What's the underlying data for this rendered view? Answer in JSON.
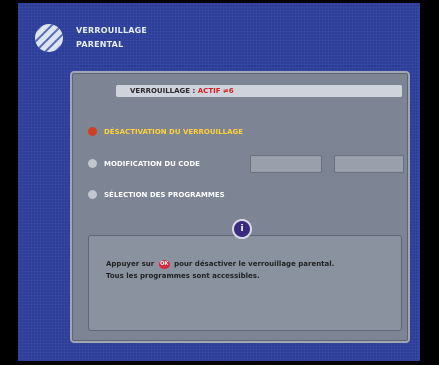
{
  "header": {
    "title_line1": "VERROUILLAGE",
    "title_line2": "PARENTAL",
    "logo_icon": "striped-sphere-icon"
  },
  "panel": {
    "status_prefix": "VERROUILLAGE : ",
    "status_value": "ACTIF ≠6",
    "menu": [
      {
        "label": "DÉSACTIVATION DU VERROUILLAGE",
        "icon": "red-dot-icon"
      },
      {
        "label": "MODIFICATION DU CODE",
        "icon": "grey-dot-icon"
      },
      {
        "label": "SÉLECTION DES PROGRAMMES",
        "icon": "grey-dot-icon"
      }
    ],
    "info_icon_text": "i",
    "message_part1": "Appuyer sur",
    "ok_button_label": "OK",
    "message_part2": "pour désactiver le verrouillage parental.",
    "message_line2": "Tous les programmes sont accessibles."
  },
  "colors": {
    "background": "#2c3e9a",
    "panel": "#7d8494",
    "highlight": "#ffd13a",
    "status_active": "#d61f1f"
  }
}
